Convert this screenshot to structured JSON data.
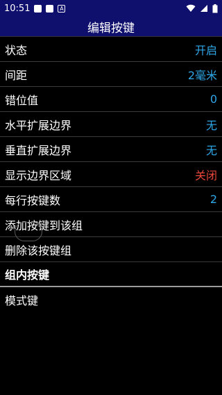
{
  "status_bar": {
    "time": "10:51",
    "a_icon_text": "A"
  },
  "title": "编辑按键",
  "settings": [
    {
      "label": "状态",
      "value": "开启",
      "value_color": "#2ea6e6"
    },
    {
      "label": "间距",
      "value": "2毫米",
      "value_color": "#2ea6e6"
    },
    {
      "label": "错位值",
      "value": "0",
      "value_color": "#2ea6e6"
    },
    {
      "label": "水平扩展边界",
      "value": "无",
      "value_color": "#2ea6e6"
    },
    {
      "label": "垂直扩展边界",
      "value": "无",
      "value_color": "#2ea6e6"
    },
    {
      "label": "显示边界区域",
      "value": "关闭",
      "value_color": "#e8473a"
    },
    {
      "label": "每行按键数",
      "value": "2",
      "value_color": "#2ea6e6"
    }
  ],
  "actions": {
    "add_key": "添加按键到该组",
    "delete_group": "删除该按键组"
  },
  "group_section": {
    "header": "组内按键",
    "items": [
      "模式键"
    ]
  }
}
